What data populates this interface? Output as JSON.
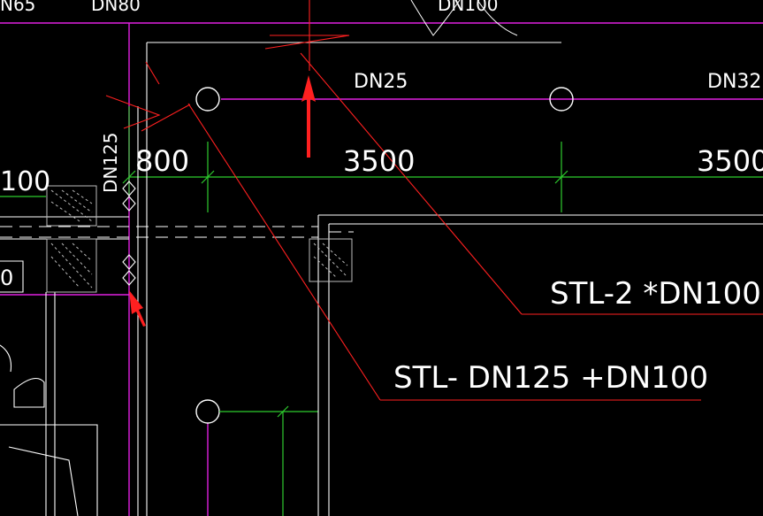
{
  "colors": {
    "background": "#000000",
    "pipe": "#e020e0",
    "dimension": "#2ecc2e",
    "leader": "#ff2020",
    "wall": "#ffffff",
    "arrow": "#ff2020"
  },
  "labels": {
    "top_dn65": "N65",
    "top_dn80": "DN80",
    "top_dn100": "DN100",
    "dn25": "DN25",
    "dn32": "DN32",
    "dn125": "DN125",
    "dn100_left": "100",
    "left_zero": "0",
    "callout_1": "STL-2 *DN100",
    "callout_2": "STL- DN125 +DN100"
  },
  "dimensions": [
    "800",
    "3500",
    "3500"
  ]
}
